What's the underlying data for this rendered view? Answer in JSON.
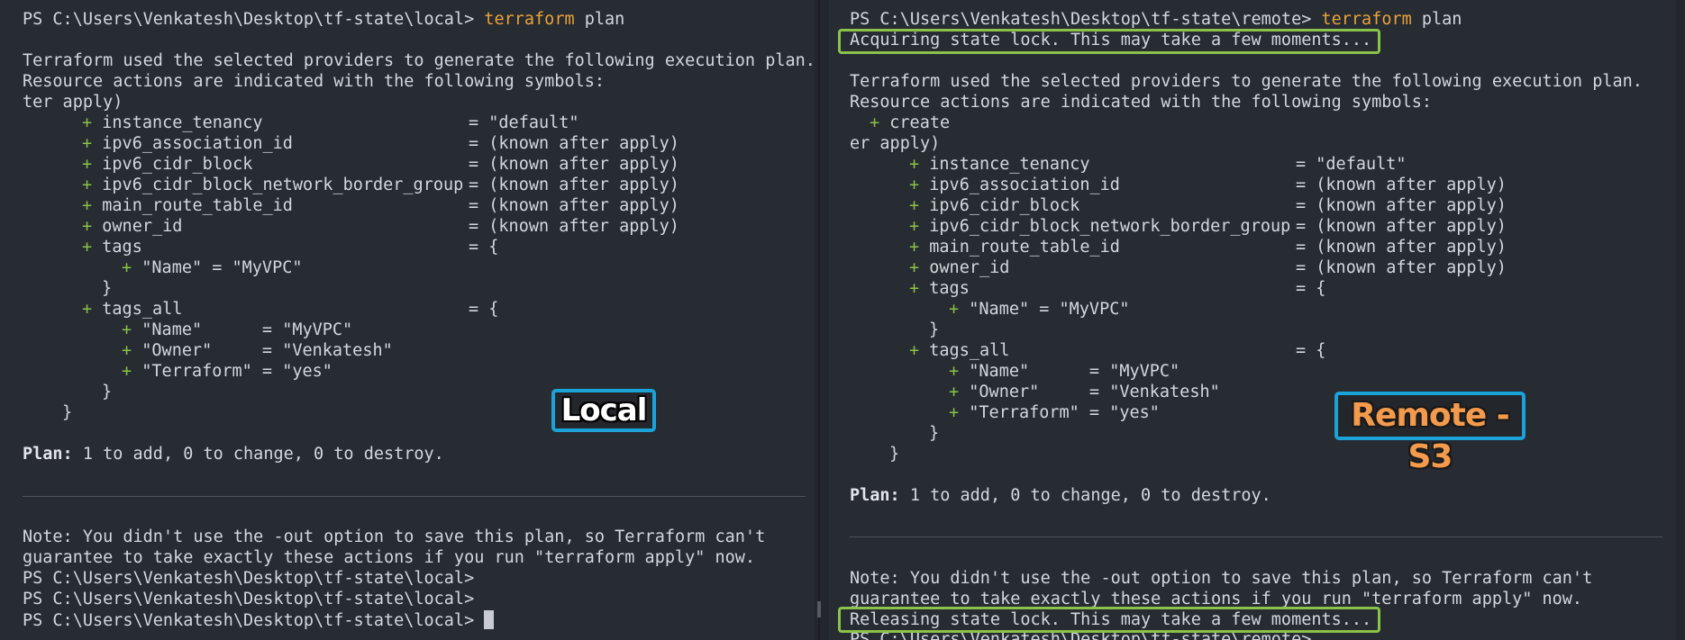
{
  "left": {
    "prompt": "PS C:\\Users\\Venkatesh\\Desktop\\tf-state\\local>",
    "cmd_word": "terraform",
    "cmd_rest": " plan",
    "intro1": "Terraform used the selected providers to generate the following execution plan.",
    "intro2": "Resource actions are indicated with the following symbols:",
    "partial": "ter apply)",
    "attrs": [
      {
        "name": "instance_tenancy",
        "value": "= \"default\""
      },
      {
        "name": "ipv6_association_id",
        "value": "= (known after apply)"
      },
      {
        "name": "ipv6_cidr_block",
        "value": "= (known after apply)"
      },
      {
        "name": "ipv6_cidr_block_network_border_group",
        "value": "= (known after apply)"
      },
      {
        "name": "main_route_table_id",
        "value": "= (known after apply)"
      },
      {
        "name": "owner_id",
        "value": "= (known after apply)"
      },
      {
        "name": "tags",
        "value": "= {"
      }
    ],
    "tag_name_line": "\"Name\" = \"MyVPC\"",
    "close_brace": "}",
    "tags_all_name": "tags_all",
    "tags_all_value": "= {",
    "tags_all_items": [
      "\"Name\"      = \"MyVPC\"",
      "\"Owner\"     = \"Venkatesh\"",
      "\"Terraform\" = \"yes\""
    ],
    "plan_label": "Plan:",
    "plan_text": " 1 to add, 0 to change, 0 to destroy.",
    "note1": "Note: You didn't use the -out option to save this plan, so Terraform can't",
    "note2": "guarantee to take exactly these actions if you run \"terraform apply\" now.",
    "tag_label": "Local"
  },
  "right": {
    "prompt": "PS C:\\Users\\Venkatesh\\Desktop\\tf-state\\remote>",
    "cmd_word": "terraform",
    "cmd_rest": " plan",
    "lock_acquire": "Acquiring state lock. This may take a few moments...",
    "intro1": "Terraform used the selected providers to generate the following execution plan.",
    "intro2": "Resource actions are indicated with the following symbols:",
    "create_symbol": "create",
    "partial": "er apply)",
    "attrs": [
      {
        "name": "instance_tenancy",
        "value": "= \"default\""
      },
      {
        "name": "ipv6_association_id",
        "value": "= (known after apply)"
      },
      {
        "name": "ipv6_cidr_block",
        "value": "= (known after apply)"
      },
      {
        "name": "ipv6_cidr_block_network_border_group",
        "value": "= (known after apply)"
      },
      {
        "name": "main_route_table_id",
        "value": "= (known after apply)"
      },
      {
        "name": "owner_id",
        "value": "= (known after apply)"
      },
      {
        "name": "tags",
        "value": "= {"
      }
    ],
    "tag_name_line": "\"Name\" = \"MyVPC\"",
    "close_brace": "}",
    "tags_all_name": "tags_all",
    "tags_all_value": "= {",
    "tags_all_items": [
      "\"Name\"      = \"MyVPC\"",
      "\"Owner\"     = \"Venkatesh\"",
      "\"Terraform\" = \"yes\""
    ],
    "plan_label": "Plan:",
    "plan_text": " 1 to add, 0 to change, 0 to destroy.",
    "note1": "Note: You didn't use the -out option to save this plan, so Terraform can't",
    "note2": "guarantee to take exactly these actions if you run \"terraform apply\" now.",
    "lock_release": "Releasing state lock. This may take a few moments...",
    "tag_label": "Remote - S3"
  },
  "colors": {
    "background": "#272b32",
    "text": "#d3d7de",
    "plus": "#8ac149",
    "command": "#e9a23b",
    "lock_highlight": "#8bc34a",
    "tag_border": "#1ba2d6",
    "remote_tag_text": "#f39a4c"
  },
  "icons": {
    "plus": "plus-icon",
    "cursor": "block-cursor"
  }
}
